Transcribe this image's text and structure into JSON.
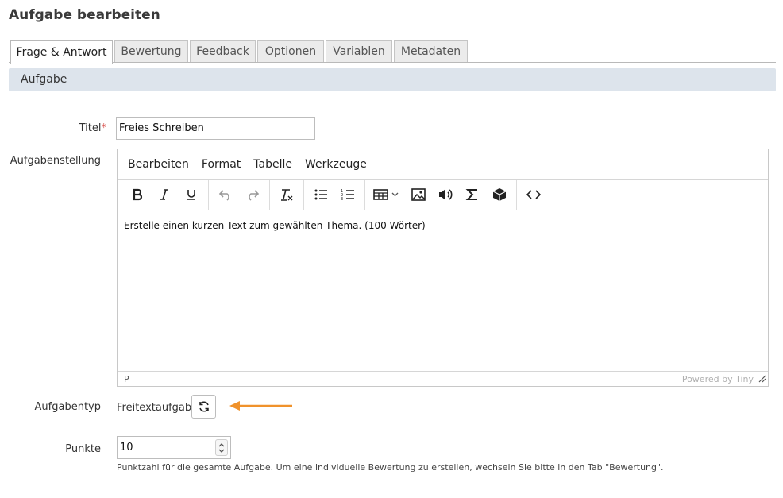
{
  "page": {
    "title": "Aufgabe bearbeiten"
  },
  "tabs": [
    {
      "label": "Frage & Antwort",
      "active": true
    },
    {
      "label": "Bewertung",
      "active": false
    },
    {
      "label": "Feedback",
      "active": false
    },
    {
      "label": "Optionen",
      "active": false
    },
    {
      "label": "Variablen",
      "active": false
    },
    {
      "label": "Metadaten",
      "active": false
    }
  ],
  "section": {
    "title": "Aufgabe"
  },
  "form": {
    "title_label": "Titel",
    "required_marker": "*",
    "title_value": "Freies Schreiben",
    "statement_label": "Aufgabenstellung",
    "type_label": "Aufgabentyp",
    "type_value": "Freitextaufgabe",
    "points_label": "Punkte",
    "points_value": "10",
    "points_help": "Punktzahl für die gesamte Aufgabe. Um eine individuelle Bewertung zu erstellen, wechseln Sie bitte in den Tab \"Bewertung\"."
  },
  "editor": {
    "menu": [
      "Bearbeiten",
      "Format",
      "Tabelle",
      "Werkzeuge"
    ],
    "toolbar_icons": [
      "bold-icon",
      "italic-icon",
      "underline-icon",
      "undo-icon",
      "redo-icon",
      "clear-format-icon",
      "bullet-list-icon",
      "numbered-list-icon",
      "table-icon",
      "image-icon",
      "audio-icon",
      "formula-icon",
      "media-icon",
      "source-code-icon"
    ],
    "content": "Erstelle einen kurzen Text zum gewählten Thema. (100 Wörter)",
    "status_path": "P",
    "powered_by": "Powered by Tiny"
  },
  "colors": {
    "accent": "#f0922b",
    "required": "#d9534f",
    "section_bg": "#dde4ec",
    "tab_bg": "#ebebeb"
  }
}
